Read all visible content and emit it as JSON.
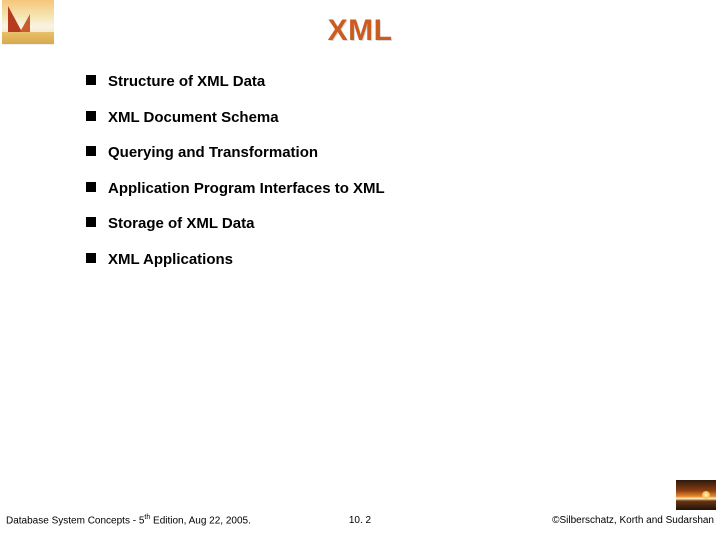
{
  "title": "XML",
  "bullets": [
    "Structure of XML Data",
    "XML Document Schema",
    "Querying and Transformation",
    "Application Program Interfaces to XML",
    "Storage of XML Data",
    "XML Applications"
  ],
  "footer": {
    "left_prefix": "Database System Concepts - 5",
    "left_sup": "th",
    "left_suffix": " Edition, Aug 22, 2005.",
    "center": "10. 2",
    "right": "©Silberschatz, Korth and Sudarshan"
  }
}
